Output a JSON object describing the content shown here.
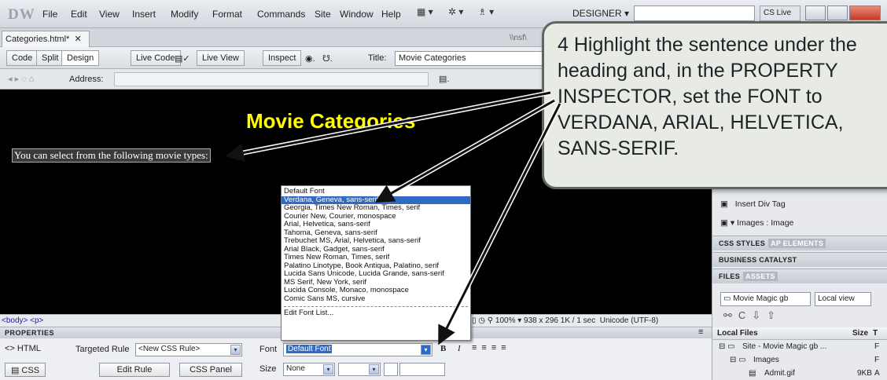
{
  "menubar": {
    "logo": "DW",
    "items": [
      "File",
      "Edit",
      "View",
      "Insert",
      "Modify",
      "Format",
      "Commands",
      "Site",
      "Window",
      "Help"
    ],
    "workspace": "DESIGNER",
    "cs_live": "CS Live"
  },
  "document": {
    "tab_label": "Categories.html*",
    "path": "\\\\nsf\\",
    "view_buttons": [
      "Code",
      "Split",
      "Design",
      "Live Code",
      "Live View",
      "Inspect"
    ],
    "title_label": "Title:",
    "title_value": "Movie Categories",
    "address_label": "Address:"
  },
  "design": {
    "heading": "Movie Categories",
    "sentence": "You can select from the following movie types:"
  },
  "font_dropdown": {
    "options": [
      "Default Font",
      "Verdana, Geneva, sans-serif",
      "Georgia, Times New Roman, Times, serif",
      "Courier New, Courier, monospace",
      "Arial, Helvetica, sans-serif",
      "Tahoma, Geneva, sans-serif",
      "Trebuchet MS, Arial, Helvetica, sans-serif",
      "Arial Black, Gadget, sans-serif",
      "Times New Roman, Times, serif",
      "Palatino Linotype, Book Antiqua, Palatino, serif",
      "Lucida Sans Unicode, Lucida Grande, sans-serif",
      "MS Serif, New York, serif",
      "Lucida Console, Monaco, monospace",
      "Comic Sans MS, cursive"
    ],
    "edit_list": "Edit Font List...",
    "selected_index": 1
  },
  "statusbar": {
    "tag_selector": "<body> <p>",
    "zoom": "100%",
    "dimensions": "938 x 296",
    "size_time": "1K / 1 sec",
    "encoding": "Unicode (UTF-8)"
  },
  "properties": {
    "title": "PROPERTIES",
    "html_label": "HTML",
    "css_label": "CSS",
    "targeted_rule_label": "Targeted Rule",
    "targeted_rule_value": "<New CSS Rule>",
    "edit_rule": "Edit Rule",
    "css_panel": "CSS Panel",
    "font_label": "Font",
    "font_value": "Default Font",
    "size_label": "Size",
    "size_value": "None",
    "bold": "B",
    "italic": "I"
  },
  "right_panel": {
    "insert_div": "Insert Div Tag",
    "images_label": "Images : Image",
    "css_tabs": [
      "CSS STYLES",
      "AP ELEMENTS"
    ],
    "business_catalyst": "BUSINESS CATALYST",
    "files_tabs": [
      "FILES",
      "ASSETS"
    ],
    "site_select": "Movie Magic gb",
    "view_select": "Local view",
    "local_files": "Local Files",
    "size_col": "Size",
    "type_col": "T",
    "tree": [
      {
        "name": "Site - Movie Magic gb ...",
        "size": "",
        "type": "F"
      },
      {
        "name": "Images",
        "size": "",
        "type": "F"
      },
      {
        "name": "Admit.gif",
        "size": "9KB",
        "type": "A"
      }
    ]
  },
  "callout": {
    "text": "4 Highlight the sentence under the heading and, in the PROPERTY INSPECTOR, set the FONT to VERDANA, ARIAL, HELVETICA, SANS-SERIF."
  },
  "colors": {
    "heading": "#ffff00",
    "design_bg": "#000000",
    "selection": "#316ac5",
    "callout_bg": "#e8ebe4"
  }
}
